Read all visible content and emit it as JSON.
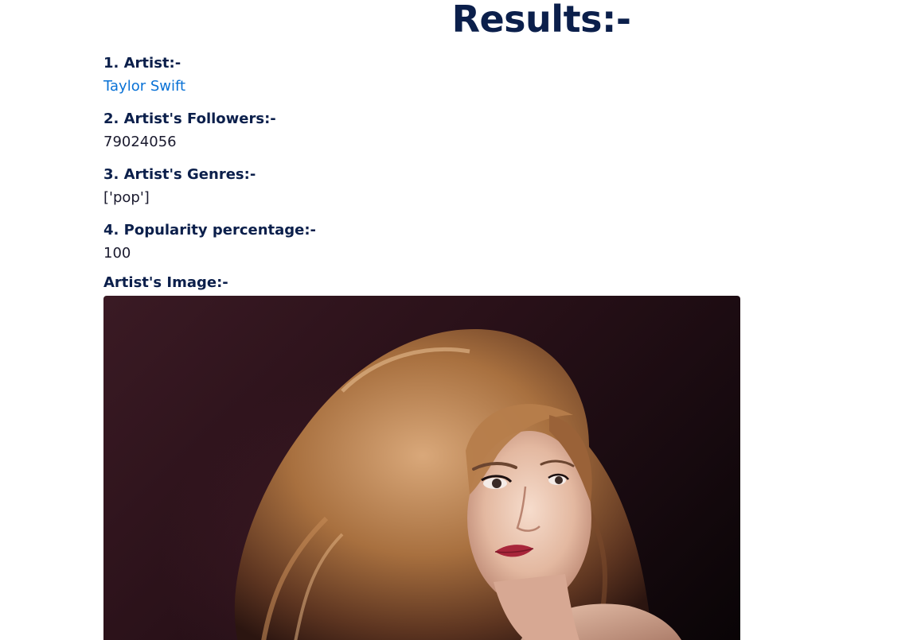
{
  "page": {
    "title": "Results:-"
  },
  "results": {
    "artist_heading": "1. Artist:-",
    "artist_name": "Taylor Swift",
    "followers_heading": "2. Artist's Followers:-",
    "followers_value": "79024056",
    "genres_heading": "3. Artist's Genres:-",
    "genres_value": "['pop']",
    "popularity_heading": "4. Popularity percentage:-",
    "popularity_value": "100",
    "image_heading": "Artist's Image:-"
  },
  "colors": {
    "heading": "#0b1f4b",
    "link": "#0a72d6",
    "text": "#1a1a2e",
    "background": "#ffffff"
  }
}
